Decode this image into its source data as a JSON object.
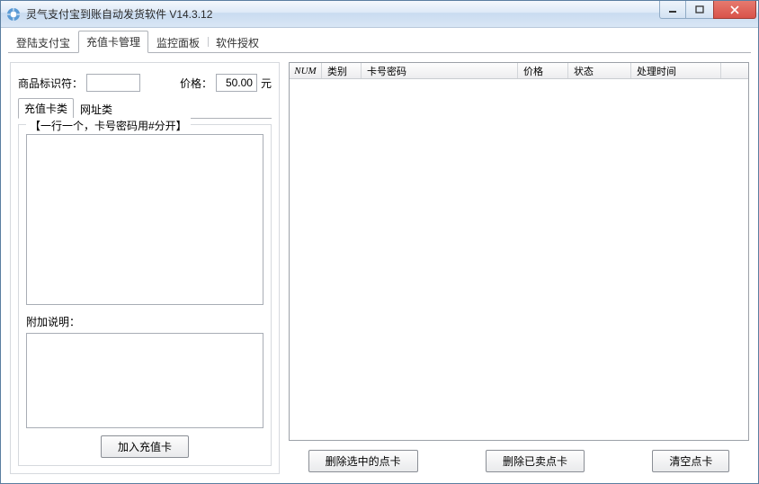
{
  "window": {
    "title": "灵气支付宝到账自动发货软件 V14.3.12"
  },
  "maintabs": {
    "t0": "登陆支付宝",
    "t1": "充值卡管理",
    "t2": "监控面板",
    "t3": "软件授权"
  },
  "left": {
    "idlabel": "商品标识符：",
    "idvalue": "",
    "pricelabel": "价格：",
    "pricevalue": "50.00",
    "priceunit": "元",
    "subtab0": "充值卡类",
    "subtab1": "网址类",
    "grouplegend": "【一行一个，卡号密码用#分开】",
    "cardsvalue": "",
    "noteslabel": "附加说明：",
    "notesvalue": "",
    "addbtn": "加入充值卡"
  },
  "list": {
    "col_num": "NUM",
    "col_cat": "类别",
    "col_code": "卡号密码",
    "col_price": "价格",
    "col_state": "状态",
    "col_time": "处理时间"
  },
  "buttons": {
    "delsel": "删除选中的点卡",
    "delsold": "删除已卖点卡",
    "clear": "清空点卡"
  }
}
